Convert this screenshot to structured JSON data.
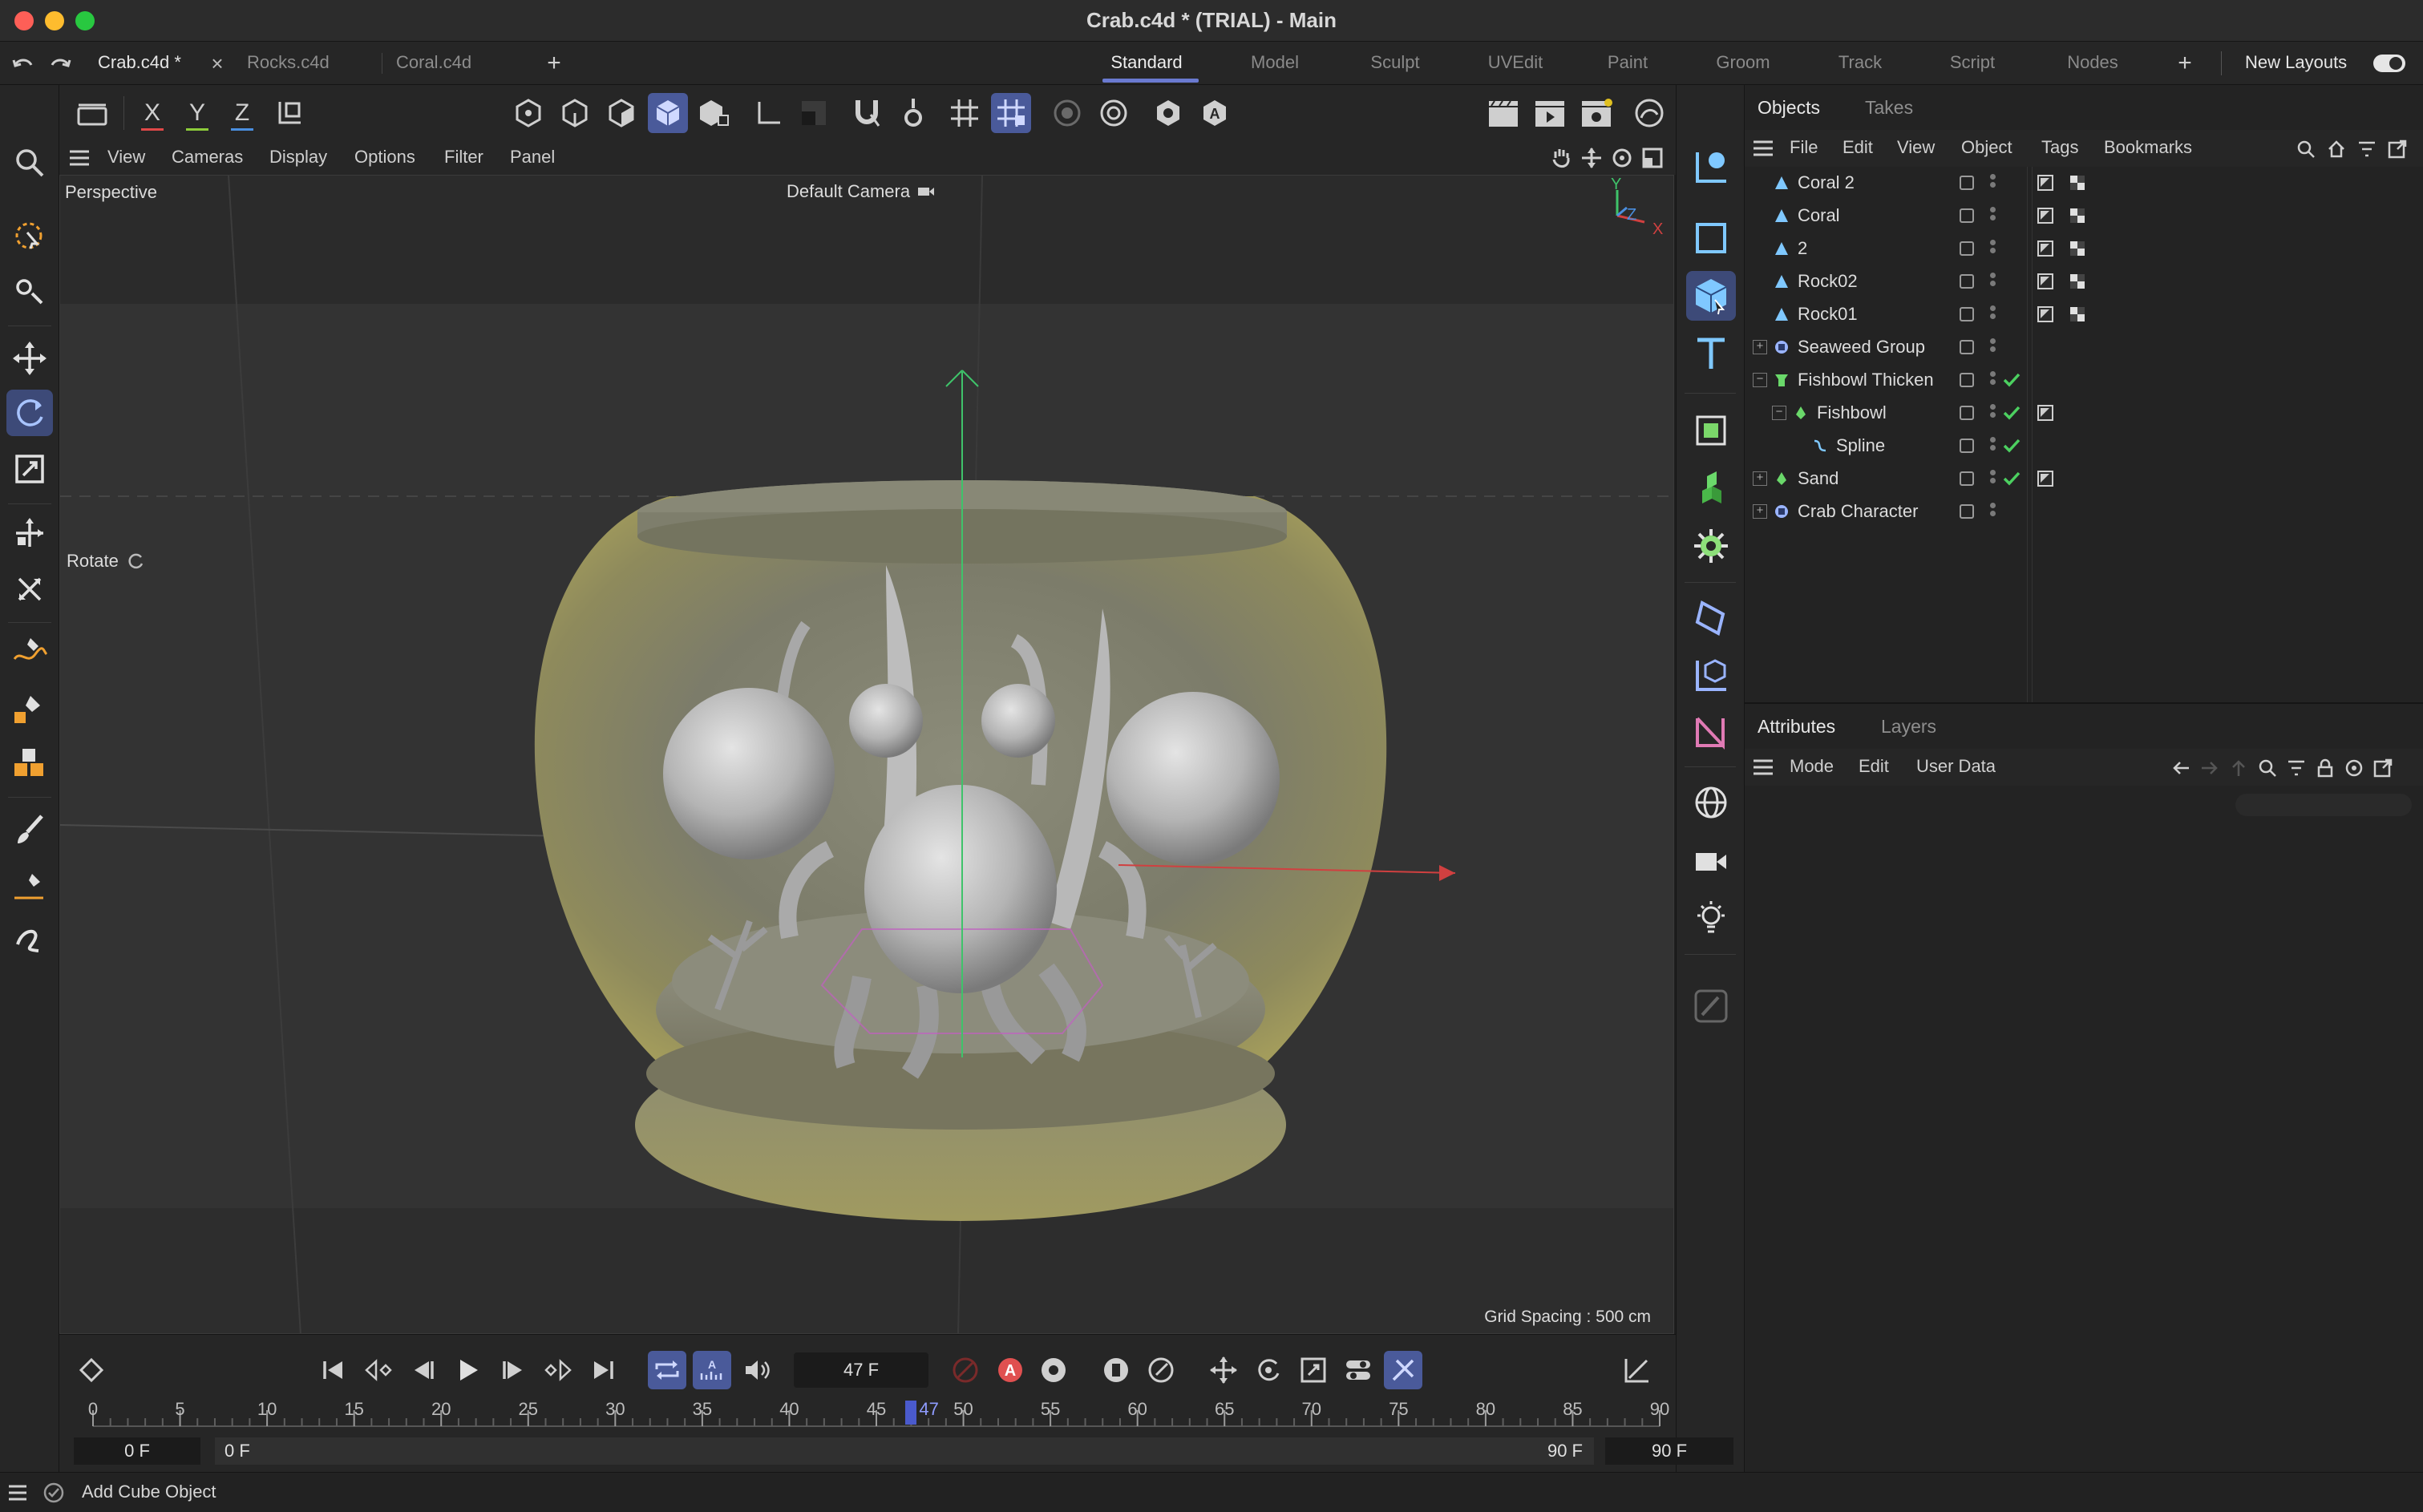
{
  "window": {
    "title": "Crab.c4d * (TRIAL) - Main",
    "traffic_colors": [
      "#fe5f57",
      "#febc2e",
      "#28c840"
    ]
  },
  "doc_tabs": [
    "Crab.c4d *",
    "Rocks.c4d",
    "Coral.c4d"
  ],
  "layouts": [
    "Standard",
    "Model",
    "Sculpt",
    "UVEdit",
    "Paint",
    "Groom",
    "Track",
    "Script",
    "Nodes"
  ],
  "new_layouts_label": "New Layouts",
  "axis": {
    "x": "X",
    "y": "Y",
    "z": "Z"
  },
  "axis_colors": {
    "x": "#e04848",
    "y": "#8dcc3a",
    "z": "#4a8fe0"
  },
  "viewport_menu": [
    "View",
    "Cameras",
    "Display",
    "Options",
    "Filter",
    "Panel"
  ],
  "viewport": {
    "name": "Perspective",
    "camera": "Default Camera",
    "tool_label": "Rotate",
    "grid_spacing": "Grid Spacing : 500 cm",
    "gizmo": {
      "y": "Y",
      "z": "Z",
      "x": "X"
    }
  },
  "objects_panel": {
    "tabs": [
      "Objects",
      "Takes"
    ],
    "menu": [
      "File",
      "Edit",
      "View",
      "Object",
      "Tags",
      "Bookmarks"
    ],
    "rows": [
      {
        "name": "Coral 2",
        "icon": "cone-icon",
        "check": false,
        "tags": 2
      },
      {
        "name": "Coral",
        "icon": "cone-icon",
        "check": false,
        "tags": 2
      },
      {
        "name": "2",
        "icon": "cone-icon",
        "check": false,
        "tags": 2
      },
      {
        "name": "Rock02",
        "icon": "cone-icon",
        "check": false,
        "tags": 2
      },
      {
        "name": "Rock01",
        "icon": "cone-icon",
        "check": false,
        "tags": 2
      },
      {
        "name": "Seaweed Group",
        "icon": "null-icon",
        "check": false,
        "tags": 0
      },
      {
        "name": "Fishbowl Thicken",
        "icon": "thicken-icon",
        "check": true,
        "tags": 0
      },
      {
        "name": "Fishbowl",
        "icon": "lathe-icon",
        "check": true,
        "tags": 1
      },
      {
        "name": "Spline",
        "icon": "spline-icon",
        "check": true,
        "tags": 0
      },
      {
        "name": "Sand",
        "icon": "lathe-icon",
        "check": true,
        "tags": 1
      },
      {
        "name": "Crab Character",
        "icon": "null-icon",
        "check": false,
        "tags": 0
      }
    ]
  },
  "attributes_panel": {
    "tabs": [
      "Attributes",
      "Layers"
    ],
    "menu": [
      "Mode",
      "Edit",
      "User Data"
    ]
  },
  "timeline": {
    "current_frame": "47 F",
    "ticks": [
      "0",
      "5",
      "10",
      "15",
      "20",
      "25",
      "30",
      "35",
      "40",
      "45",
      "50",
      "55",
      "60",
      "65",
      "70",
      "75",
      "80",
      "85",
      "90"
    ],
    "playhead_value": 47,
    "playhead_label": "47",
    "frame_max": 90,
    "start": "0 F",
    "range_start": "0 F",
    "range_end": "90 F",
    "end": "90 F"
  },
  "status_text": "Add Cube Object",
  "accent_color": "#4a5a9a"
}
